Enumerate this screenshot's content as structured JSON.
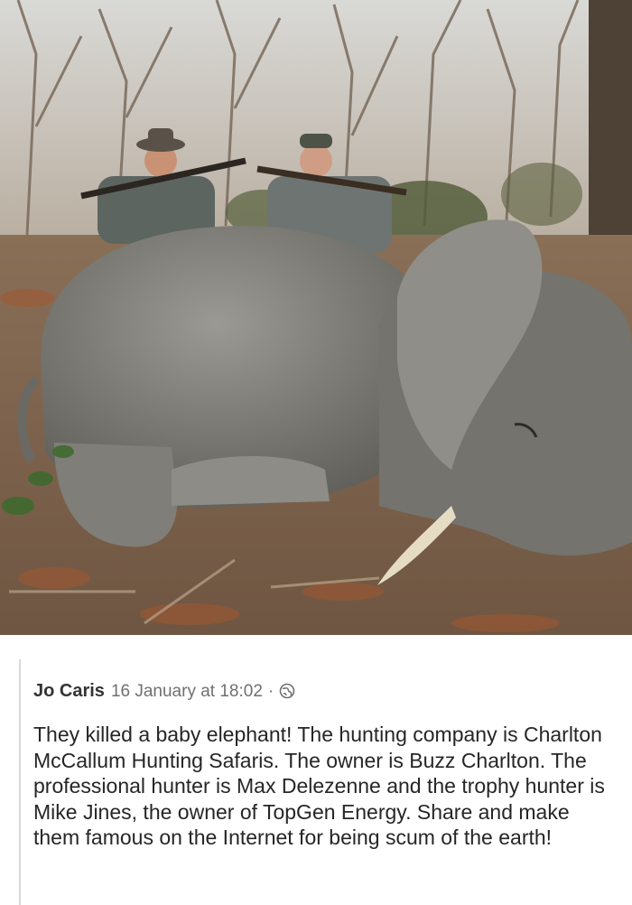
{
  "post": {
    "author": "Jo Caris",
    "timestamp": "16 January at 18:02",
    "separator": "·",
    "privacy_icon": "globe-icon",
    "text": "They killed a baby elephant! The hunting company is Charlton McCallum Hunting Safaris. The owner is Buzz Charlton. The professional hunter is Max Delezenne and the trophy hunter is Mike Jines, the owner of TopGen Energy. Share and make them famous on the Internet for being scum of the earth!"
  },
  "colors": {
    "author": "#333333",
    "meta": "#707070",
    "body_text": "#262626",
    "rule": "#d8d8d8"
  }
}
